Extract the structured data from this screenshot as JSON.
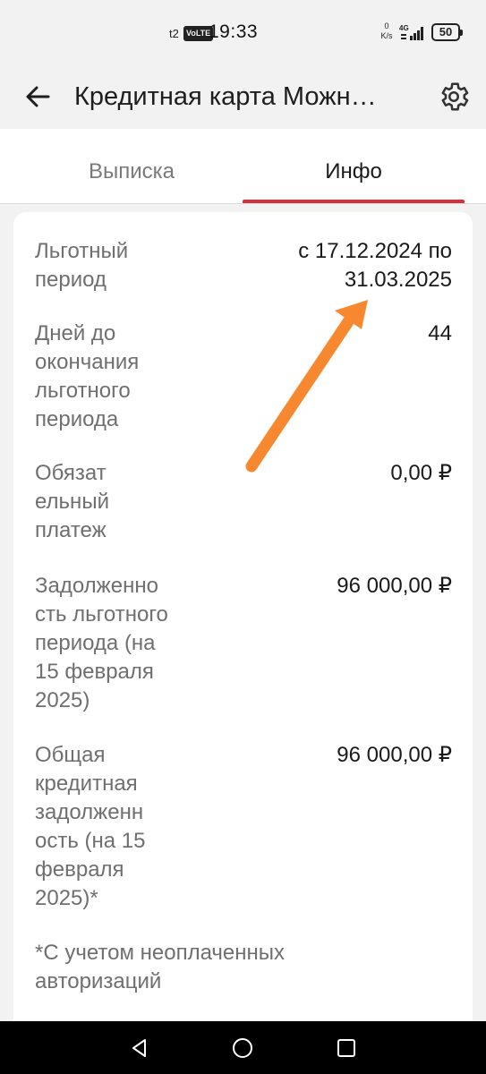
{
  "status_bar": {
    "carrier": "t2",
    "volte": "VoLTE",
    "time": "19:33",
    "net_speed_value": "0",
    "net_speed_unit": "K/s",
    "network": "4G",
    "battery": "50"
  },
  "app_bar": {
    "title": "Кредитная карта Можн…",
    "back_icon": "arrow-left-icon",
    "settings_icon": "gear-icon"
  },
  "tabs": [
    {
      "label": "Выписка",
      "active": false
    },
    {
      "label": "Инфо",
      "active": true
    }
  ],
  "info": {
    "grace_period": {
      "label_1": "Льготный",
      "label_2": "период",
      "value_1": "с 17.12.2024 по",
      "value_2": "31.03.2025"
    },
    "days_left": {
      "label_1": "Дней до",
      "label_2": "окончания",
      "label_3": "льготного",
      "label_4": "периода",
      "value": "44"
    },
    "mandatory_payment": {
      "label_1": "Обязат",
      "label_2": "ельный",
      "label_3": "платеж",
      "value": "0,00 ₽"
    },
    "grace_debt": {
      "label_1": "Задолженно",
      "label_2": "сть льготного",
      "label_3": "периода (на",
      "label_4": "15 февраля",
      "label_5": "2025)",
      "value": "96 000,00 ₽"
    },
    "total_debt": {
      "label_1": "Общая",
      "label_2": "кредитная",
      "label_3": "задолженн",
      "label_4": "ость (на 15",
      "label_5": "февраля",
      "label_6": "2025)*",
      "value": "96 000,00 ₽"
    },
    "footnote_1": "*С учетом неоплаченных",
    "footnote_2": "авторизаций"
  },
  "annotation": {
    "color": "#f7882f"
  },
  "nav_bar": {
    "back_icon": "nav-back-icon",
    "home_icon": "nav-home-icon",
    "recents_icon": "nav-recents-icon"
  },
  "colors": {
    "accent": "#d4313c",
    "background": "#f2f2f2",
    "card": "#ffffff"
  }
}
